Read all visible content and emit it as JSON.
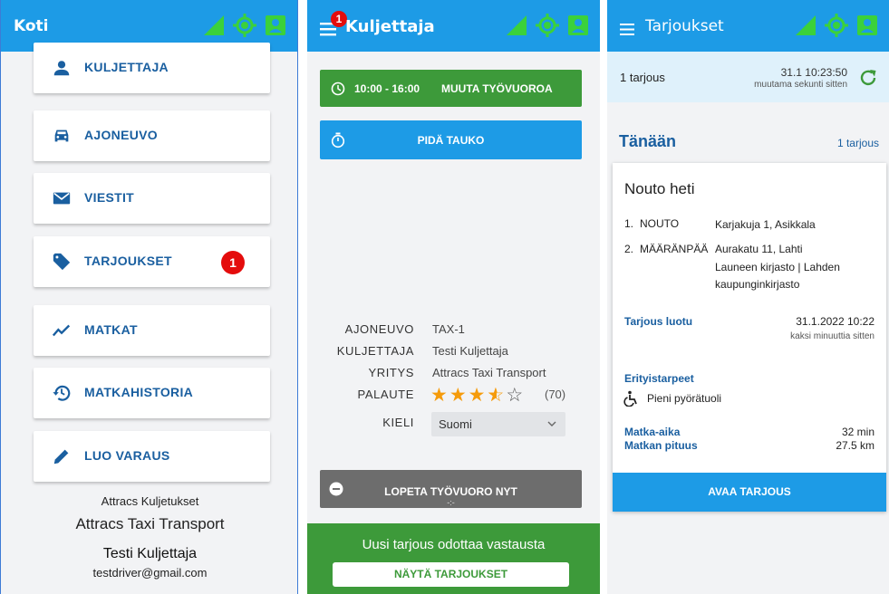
{
  "panel1": {
    "title": "Koti",
    "menu": [
      {
        "label": "KULJETTAJA",
        "icon": "person-icon"
      },
      {
        "label": "AJONEUVO",
        "icon": "car-icon"
      },
      {
        "label": "VIESTIT",
        "icon": "mail-icon"
      },
      {
        "label": "TARJOUKSET",
        "icon": "tag-icon",
        "badge": "1"
      },
      {
        "label": "MATKAT",
        "icon": "trending-icon"
      },
      {
        "label": "MATKAHISTORIA",
        "icon": "history-icon"
      },
      {
        "label": "LUO VARAUS",
        "icon": "pencil-icon"
      }
    ],
    "footer": {
      "app_name": "Attracs Kuljetukset",
      "company": "Attracs Taxi Transport",
      "driver": "Testi Kuljettaja",
      "email": "testdriver@gmail.com"
    }
  },
  "panel2": {
    "title": "Kuljettaja",
    "menu_badge": "1",
    "shift_time": "10:00 - 16:00",
    "shift_button": "MUUTA TYÖVUOROA",
    "break_button": "PIDÄ TAUKO",
    "info": {
      "vehicle_label": "AJONEUVO",
      "vehicle": "TAX-1",
      "driver_label": "KULJETTAJA",
      "driver": "Testi Kuljettaja",
      "company_label": "YRITYS",
      "company": "Attracs Taxi Transport",
      "feedback_label": "PALAUTE",
      "rating": 3.5,
      "rating_count": "(70)",
      "language_label": "KIELI",
      "language": "Suomi"
    },
    "end_shift_button": "LOPETA TYÖVUORO NYT",
    "end_shift_sub": "-:-",
    "banner_text": "Uusi tarjous odottaa vastausta",
    "banner_button": "NÄYTÄ TARJOUKSET"
  },
  "panel3": {
    "title": "Tarjoukset",
    "count": "1 tarjous",
    "updated": "31.1 10:23:50",
    "updated_rel": "muutama sekunti sitten",
    "section_title": "Tänään",
    "section_count": "1 tarjous",
    "card": {
      "heading": "Nouto heti",
      "stop1_num": "1.",
      "stop1_label": "NOUTO",
      "stop1_addr": "Karjakuja 1, Asikkala",
      "stop2_num": "2.",
      "stop2_label": "MÄÄRÄNPÄÄ",
      "stop2_addr": "Aurakatu 11, Lahti",
      "stop2_detail1": "Launeen kirjasto | Lahden",
      "stop2_detail2": "kaupunginkirjasto",
      "created_label": "Tarjous luotu",
      "created_value": "31.1.2022 10:22",
      "created_rel": "kaksi minuuttia sitten",
      "needs_label": "Erityistarpeet",
      "needs_value": "Pieni pyörätuoli",
      "duration_label": "Matka-aika",
      "duration_value": "32 min",
      "distance_label": "Matkan pituus",
      "distance_value": "27.5 km",
      "open_button": "AVAA TARJOUS"
    }
  },
  "colors": {
    "primary": "#1d9be6",
    "accent_green": "#3bd13b",
    "success": "#3d9a3a",
    "danger": "#e40c0c",
    "link": "#1a5fa0",
    "star": "#f59b0b"
  }
}
